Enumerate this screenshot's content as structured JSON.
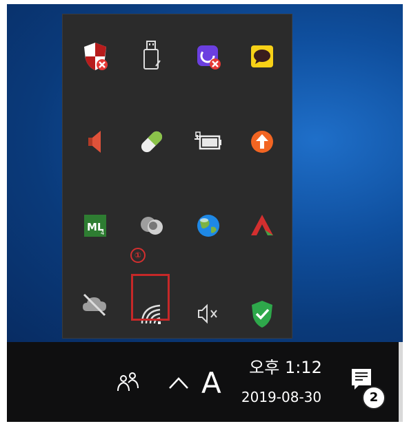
{
  "tray": {
    "marker": "①",
    "icons": [
      [
        "defender-warning-icon",
        "usb-safely-remove-icon",
        "app-error-icon",
        "kakaotalk-icon"
      ],
      [
        "speaker-icon",
        "capsule-icon",
        "battery-plug-icon",
        "update-arrow-icon"
      ],
      [
        "ml-app-icon",
        "cloud-circles-icon",
        "globe-icon",
        "acrobat-icon"
      ],
      [
        "onedrive-disabled-icon",
        "wifi-icon",
        "volume-muted-icon",
        "security-check-icon"
      ]
    ],
    "selected_icon": "wifi-icon"
  },
  "taskbar": {
    "ime_label": "A",
    "clock_time": "오후 1:12",
    "clock_date": "2019-08-30",
    "notifications_count": "2"
  },
  "colors": {
    "highlight": "#c62828",
    "popup_bg": "#2b2b2b",
    "taskbar_bg": "#0f0f10"
  }
}
